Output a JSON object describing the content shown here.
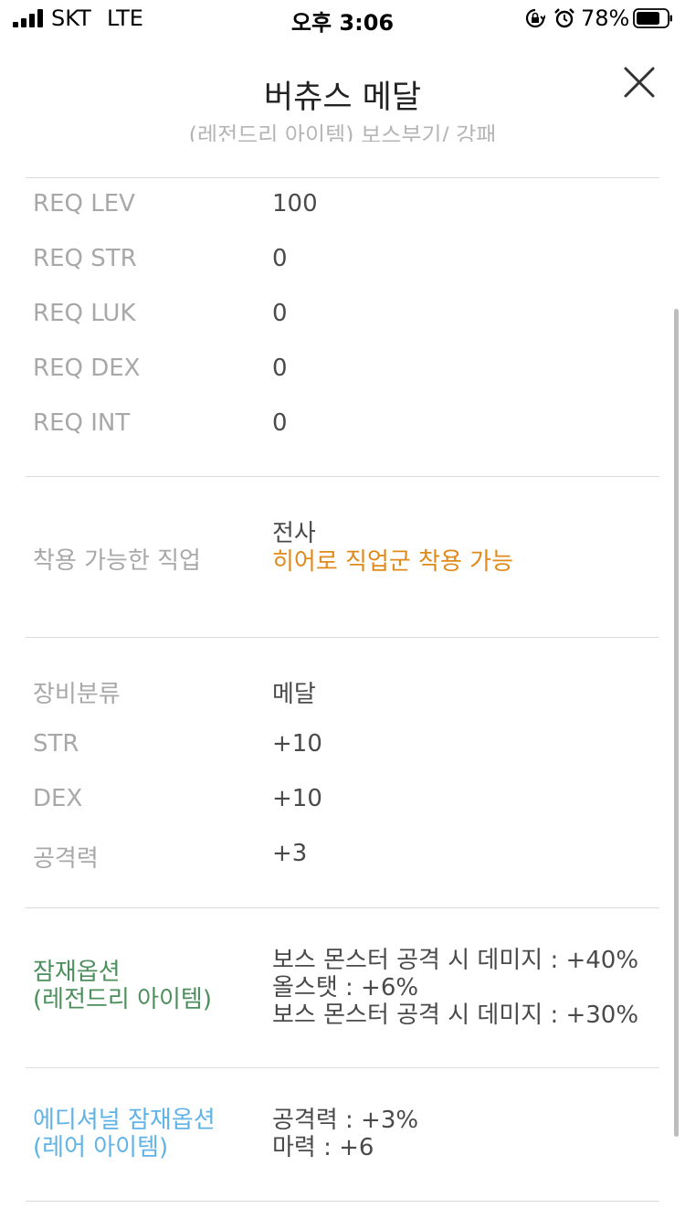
{
  "status_bar": {
    "carrier": "SKT",
    "network": "LTE",
    "time": "오후 3:06",
    "battery_percent": "78%",
    "battery_level": 0.78
  },
  "header": {
    "title": "버츄스 메달",
    "subtitle_partial": "(레전드리 아이템) 보스부기/ 강패"
  },
  "requirements": [
    {
      "label": "REQ LEV",
      "value": "100"
    },
    {
      "label": "REQ STR",
      "value": "0"
    },
    {
      "label": "REQ LUK",
      "value": "0"
    },
    {
      "label": "REQ DEX",
      "value": "0"
    },
    {
      "label": "REQ INT",
      "value": "0"
    }
  ],
  "job": {
    "label": "착용 가능한 직업",
    "value": "전사",
    "note": "히어로 직업군 착용 가능"
  },
  "stats": [
    {
      "label": "장비분류",
      "value": "메달"
    },
    {
      "label": "STR",
      "value": "+10"
    },
    {
      "label": "DEX",
      "value": "+10"
    },
    {
      "label": "공격력",
      "value": "+3"
    }
  ],
  "potential": {
    "label_line1": "잠재옵션",
    "label_line2": "(레전드리 아이템)",
    "lines": [
      "보스 몬스터 공격 시 데미지 : +40%",
      "올스탯 : +6%",
      "보스 몬스터 공격 시 데미지 : +30%"
    ],
    "color": "#4c8f5c"
  },
  "additional_potential": {
    "label_line1": "에디셔널 잠재옵션",
    "label_line2": "(레어 아이템)",
    "lines": [
      "공격력 : +3%",
      "마력 : +6"
    ],
    "color": "#5fb3e6"
  },
  "accent_colors": {
    "job_note": "#e08a1a"
  }
}
